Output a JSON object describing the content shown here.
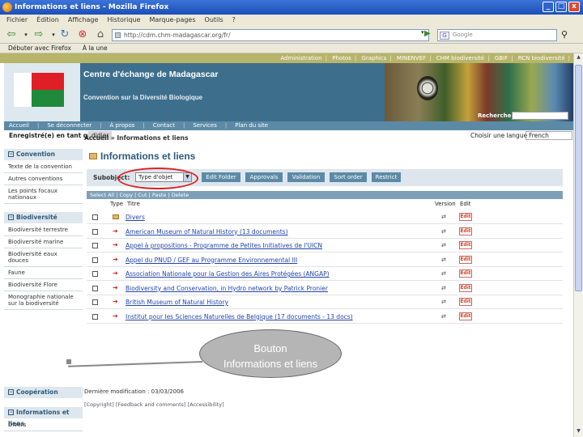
{
  "window": {
    "title": "Informations et liens - Mozilla Firefox",
    "btn_min": "_",
    "btn_max": "□",
    "btn_close": "x"
  },
  "menubar": [
    "Fichier",
    "Édition",
    "Affichage",
    "Historique",
    "Marque-pages",
    "Outils",
    "?"
  ],
  "navbar": {
    "url": "http://cdm.chm-madagascar.org/fr/",
    "search_placeholder": "Google"
  },
  "bookmarks": [
    "Débuter avec Firefox",
    "À la une"
  ],
  "toplinks": [
    "Administration",
    "Photos",
    "Graphics",
    "MINENVEF",
    "CHM biodiversité",
    "GBIF",
    "RCN biodiversité"
  ],
  "banner": {
    "title": "Centre d'échange de Madagascar",
    "subtitle": "Convention sur la Diversité Biologique",
    "search_label": "Recherche :"
  },
  "sitemenu": [
    "Accueil",
    "Se déconnecter",
    "À propos",
    "Contact",
    "Services",
    "Plan du site"
  ],
  "userbar": {
    "label": "Enregistré(e) en tant que :",
    "user": "didier",
    "lang_label": "Choisir une langue",
    "lang_value": "French"
  },
  "breadcrumb": "Accueil » Informations et liens",
  "sidebar": {
    "sections": [
      {
        "head": "Convention",
        "items": [
          "Texte de la convention",
          "Autres conventions",
          "Les points focaux nationaux"
        ]
      },
      {
        "head": "Biodiversité",
        "items": [
          "Biodiversité terrestre",
          "Biodiversité marine",
          "Biodiversité eaux douces",
          "Faune",
          "Biodiversité Flore",
          "Monographie nationale sur la biodiversité"
        ]
      }
    ],
    "bottom": [
      {
        "head": "Coopération",
        "items": []
      },
      {
        "head": "Informations et liens",
        "items": [
          "Divers"
        ]
      }
    ]
  },
  "panel": {
    "title": "Informations et liens",
    "subobject_label": "Subobject:",
    "type_value": "Type d'objet",
    "buttons": [
      "Edit Folder",
      "Approvals",
      "Validation",
      "Sort order",
      "Restrict"
    ],
    "select_bar": "Select All | Copy | Cut | Paste | Delete",
    "headers": {
      "type": "Type",
      "title": "Titre",
      "version": "Version",
      "edit": "Edit"
    },
    "rows": [
      {
        "icon": "folder",
        "title": "Divers",
        "edit": "Edit"
      },
      {
        "icon": "link",
        "title": "American Museum of Natural History (13 documents)",
        "edit": "Edit"
      },
      {
        "icon": "link",
        "title": "Appel à propositions - Programme de Petites Initiatives de l'UICN",
        "edit": "Edit"
      },
      {
        "icon": "link",
        "title": "Appel du PNUD / GEF au Programme Environnemental III",
        "edit": "Edit"
      },
      {
        "icon": "link",
        "title": "Association Nationale pour la Gestion des Aires Protégées (ANGAP)",
        "edit": "Edit"
      },
      {
        "icon": "link",
        "title": "Biodiversity and Conservation, in Hydro network by Patrick Pronier",
        "edit": "Edit"
      },
      {
        "icon": "link",
        "title": "British Museum of Natural History",
        "edit": "Edit"
      },
      {
        "icon": "link",
        "title": "Institut pour les Sciences Naturelles de Belgique (17 documents - 13 docs)",
        "edit": "Edit"
      }
    ]
  },
  "lastmod": "Dernière modification : 03/03/2006",
  "footer": "[Copyright] [Feedback and comments] [Accessibility]",
  "callout": {
    "line1": "Bouton",
    "line2": "Informations et liens"
  }
}
